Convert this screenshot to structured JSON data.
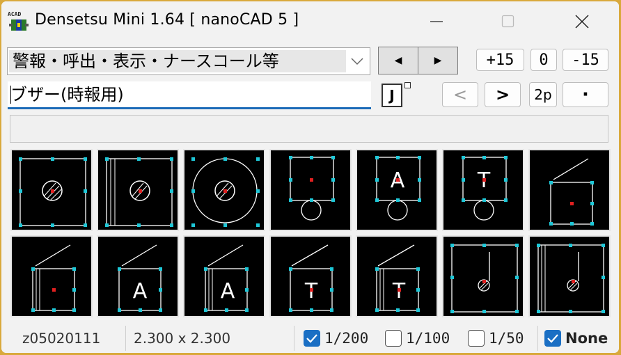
{
  "window": {
    "title": "Densetsu Mini 1.64 [ nanoCAD 5 ]",
    "icon_text": "ACAD"
  },
  "category": {
    "selected": "警報・呼出・表示・ナースコール等"
  },
  "symbol_name": {
    "value": "ブザー(時報用)"
  },
  "nav": {
    "prev_glyph": "◀",
    "next_glyph": "▶"
  },
  "scale_buttons": {
    "plus15": "+15",
    "zero": "0",
    "minus15": "-15"
  },
  "j_button": "J",
  "paging": {
    "back": "<",
    "forward": ">",
    "two_page": "2p",
    "dot": "·"
  },
  "tile_letters": {
    "r0c3": "",
    "r0c4": "A",
    "r0c5": "T",
    "r1c1": "A",
    "r1c2": "A",
    "r1c3": "T",
    "r1c4": "T"
  },
  "statusbar": {
    "code": "z05020111",
    "size": "2.300 x 2.300",
    "scales": [
      {
        "label": "1/200",
        "checked": true
      },
      {
        "label": "1/100",
        "checked": false
      },
      {
        "label": "1/50",
        "checked": false
      }
    ],
    "none": {
      "label": "None",
      "checked": true
    }
  },
  "colors": {
    "accent": "#1a6fc4",
    "grip": "#1ec8d8",
    "marker": "#e02020",
    "tile_bg": "#000000"
  }
}
